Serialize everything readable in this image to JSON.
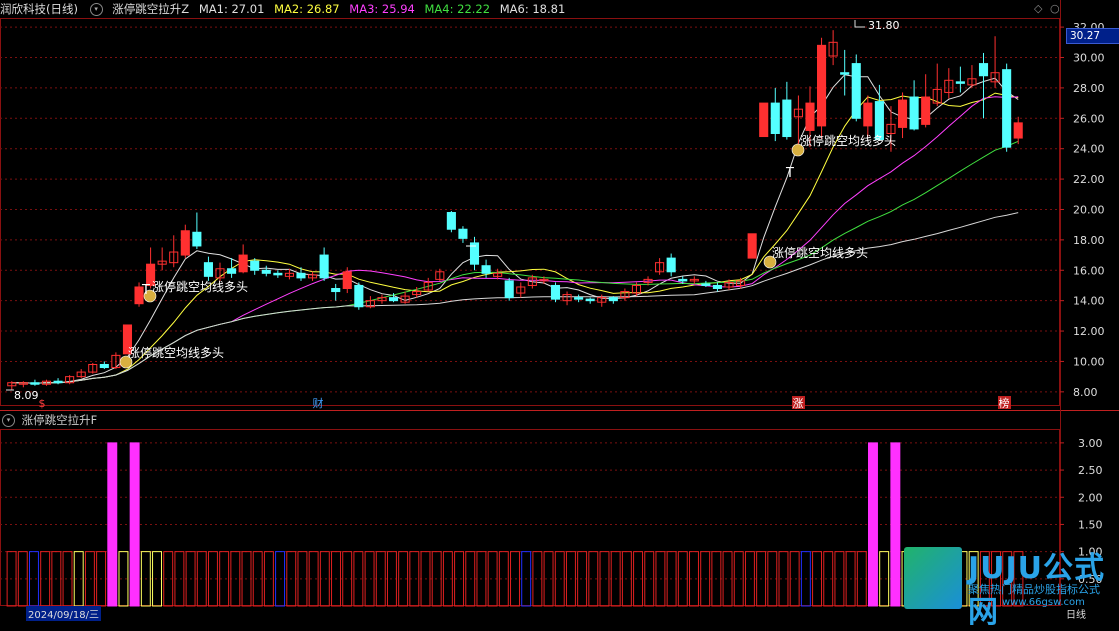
{
  "header": {
    "title": "润欣科技(日线)",
    "indicator": "涨停跳空拉升Z",
    "ma": [
      {
        "label": "MA1: 27.01",
        "color": "#e0e0e0"
      },
      {
        "label": "MA2: 26.87",
        "color": "#ffff40"
      },
      {
        "label": "MA3: 25.94",
        "color": "#ff40ff"
      },
      {
        "label": "MA4: 22.22",
        "color": "#40e040"
      },
      {
        "label": "MA6: 18.81",
        "color": "#e0e0e0"
      }
    ],
    "corner_icons": [
      "diamond-icon",
      "circle-icon"
    ]
  },
  "price_tag": "30.27",
  "sub_header": "涨停跳空拉升F",
  "bottom": {
    "date_label": "2024/09/18/三",
    "right_label": "日线"
  },
  "logo": {
    "title": "JUJU公式网",
    "slogan": "聚焦热门精品炒股指标公式",
    "url": "www.66gsw.com"
  },
  "chart_data": [
    {
      "type": "candlestick",
      "y_ticks": [
        "32.00",
        "30.00",
        "28.00",
        "26.00",
        "24.00",
        "22.00",
        "20.00",
        "18.00",
        "16.00",
        "14.00",
        "12.00",
        "10.00",
        "8.00"
      ],
      "ylim": [
        7.2,
        32.6
      ],
      "annotations": {
        "high_label": "31.80",
        "low_label": "8.09",
        "signal_text": "涨停跳空均线多头",
        "marker_letter": "T"
      },
      "event_labels": [
        "$",
        "财",
        "涨",
        "榜"
      ],
      "candles": [
        {
          "o": 8.4,
          "c": 8.6,
          "h": 8.7,
          "l": 8.1
        },
        {
          "o": 8.5,
          "c": 8.6,
          "h": 8.7,
          "l": 8.3
        },
        {
          "o": 8.6,
          "c": 8.5,
          "h": 8.8,
          "l": 8.4
        },
        {
          "o": 8.5,
          "c": 8.7,
          "h": 8.8,
          "l": 8.4
        },
        {
          "o": 8.7,
          "c": 8.6,
          "h": 8.9,
          "l": 8.5
        },
        {
          "o": 8.6,
          "c": 9.0,
          "h": 9.1,
          "l": 8.5
        },
        {
          "o": 9.0,
          "c": 9.3,
          "h": 9.5,
          "l": 8.9
        },
        {
          "o": 9.3,
          "c": 9.8,
          "h": 9.9,
          "l": 9.2
        },
        {
          "o": 9.8,
          "c": 9.6,
          "h": 10.0,
          "l": 9.5
        },
        {
          "o": 9.6,
          "c": 10.4,
          "h": 10.6,
          "l": 9.5
        },
        {
          "o": 10.5,
          "c": 12.4,
          "h": 12.4,
          "l": 10.5
        },
        {
          "o": 13.8,
          "c": 14.9,
          "h": 15.2,
          "l": 13.6
        },
        {
          "o": 15.0,
          "c": 16.4,
          "h": 17.5,
          "l": 14.8
        },
        {
          "o": 16.4,
          "c": 16.6,
          "h": 17.5,
          "l": 16.0
        },
        {
          "o": 16.5,
          "c": 17.2,
          "h": 18.3,
          "l": 16.2
        },
        {
          "o": 17.0,
          "c": 18.6,
          "h": 19.0,
          "l": 16.8
        },
        {
          "o": 18.5,
          "c": 17.6,
          "h": 19.8,
          "l": 17.4
        },
        {
          "o": 16.5,
          "c": 15.6,
          "h": 16.9,
          "l": 15.3
        },
        {
          "o": 15.5,
          "c": 16.1,
          "h": 16.5,
          "l": 15.3
        },
        {
          "o": 16.1,
          "c": 15.8,
          "h": 16.8,
          "l": 15.5
        },
        {
          "o": 15.9,
          "c": 17.0,
          "h": 17.7,
          "l": 15.8
        },
        {
          "o": 16.6,
          "c": 16.0,
          "h": 16.8,
          "l": 15.7
        },
        {
          "o": 16.0,
          "c": 15.8,
          "h": 16.3,
          "l": 15.6
        },
        {
          "o": 15.8,
          "c": 15.7,
          "h": 16.0,
          "l": 15.5
        },
        {
          "o": 15.6,
          "c": 15.8,
          "h": 16.1,
          "l": 15.4
        },
        {
          "o": 15.8,
          "c": 15.5,
          "h": 16.2,
          "l": 15.3
        },
        {
          "o": 15.5,
          "c": 15.7,
          "h": 15.9,
          "l": 15.3
        },
        {
          "o": 17.0,
          "c": 15.5,
          "h": 17.5,
          "l": 15.3
        },
        {
          "o": 14.8,
          "c": 14.6,
          "h": 15.1,
          "l": 14.0
        },
        {
          "o": 14.8,
          "c": 15.9,
          "h": 16.2,
          "l": 14.5
        },
        {
          "o": 15.0,
          "c": 13.6,
          "h": 15.2,
          "l": 13.4
        },
        {
          "o": 13.6,
          "c": 14.0,
          "h": 14.3,
          "l": 13.5
        },
        {
          "o": 14.0,
          "c": 14.2,
          "h": 14.4,
          "l": 13.8
        },
        {
          "o": 14.2,
          "c": 14.0,
          "h": 14.5,
          "l": 13.9
        },
        {
          "o": 13.9,
          "c": 14.3,
          "h": 14.6,
          "l": 13.8
        },
        {
          "o": 14.4,
          "c": 14.6,
          "h": 14.9,
          "l": 14.2
        },
        {
          "o": 14.7,
          "c": 15.2,
          "h": 15.5,
          "l": 14.6
        },
        {
          "o": 15.4,
          "c": 15.9,
          "h": 16.1,
          "l": 15.3
        },
        {
          "o": 19.8,
          "c": 18.7,
          "h": 19.9,
          "l": 18.5
        },
        {
          "o": 18.7,
          "c": 18.1,
          "h": 18.9,
          "l": 17.8
        },
        {
          "o": 17.8,
          "c": 16.4,
          "h": 18.2,
          "l": 16.0
        },
        {
          "o": 16.3,
          "c": 15.8,
          "h": 16.7,
          "l": 15.5
        },
        {
          "o": 15.6,
          "c": 15.8,
          "h": 16.1,
          "l": 15.4
        },
        {
          "o": 15.3,
          "c": 14.2,
          "h": 15.5,
          "l": 14.0
        },
        {
          "o": 14.5,
          "c": 14.9,
          "h": 15.2,
          "l": 14.2
        },
        {
          "o": 15.0,
          "c": 15.5,
          "h": 15.7,
          "l": 14.8
        },
        {
          "o": 15.3,
          "c": 15.4,
          "h": 15.6,
          "l": 15.1
        },
        {
          "o": 15.0,
          "c": 14.1,
          "h": 15.2,
          "l": 13.9
        },
        {
          "o": 14.0,
          "c": 14.4,
          "h": 14.6,
          "l": 13.7
        },
        {
          "o": 14.2,
          "c": 14.1,
          "h": 14.4,
          "l": 13.9
        },
        {
          "o": 14.1,
          "c": 14.0,
          "h": 14.2,
          "l": 13.8
        },
        {
          "o": 13.9,
          "c": 14.2,
          "h": 14.4,
          "l": 13.6
        },
        {
          "o": 14.2,
          "c": 14.0,
          "h": 14.3,
          "l": 13.8
        },
        {
          "o": 14.2,
          "c": 14.6,
          "h": 14.8,
          "l": 14.0
        },
        {
          "o": 14.5,
          "c": 15.0,
          "h": 15.2,
          "l": 14.3
        },
        {
          "o": 15.2,
          "c": 15.4,
          "h": 15.6,
          "l": 15.0
        },
        {
          "o": 15.9,
          "c": 16.5,
          "h": 16.8,
          "l": 15.7
        },
        {
          "o": 16.8,
          "c": 15.9,
          "h": 17.1,
          "l": 15.6
        },
        {
          "o": 15.4,
          "c": 15.3,
          "h": 15.6,
          "l": 15.1
        },
        {
          "o": 15.3,
          "c": 15.4,
          "h": 15.6,
          "l": 15.1
        },
        {
          "o": 15.1,
          "c": 15.0,
          "h": 15.3,
          "l": 14.9
        },
        {
          "o": 15.0,
          "c": 14.8,
          "h": 15.2,
          "l": 14.6
        },
        {
          "o": 14.9,
          "c": 15.2,
          "h": 15.4,
          "l": 14.7
        },
        {
          "o": 15.0,
          "c": 15.3,
          "h": 15.5,
          "l": 14.8
        },
        {
          "o": 16.8,
          "c": 18.4,
          "h": 18.4,
          "l": 16.8
        },
        {
          "o": 24.8,
          "c": 27.0,
          "h": 27.0,
          "l": 24.8
        },
        {
          "o": 27.0,
          "c": 25.0,
          "h": 28.0,
          "l": 24.5
        },
        {
          "o": 27.2,
          "c": 24.8,
          "h": 28.4,
          "l": 24.6
        },
        {
          "o": 26.1,
          "c": 26.6,
          "h": 27.5,
          "l": 24.0
        },
        {
          "o": 25.2,
          "c": 27.0,
          "h": 28.1,
          "l": 24.1
        },
        {
          "o": 25.5,
          "c": 30.8,
          "h": 31.3,
          "l": 24.6
        },
        {
          "o": 30.1,
          "c": 31.0,
          "h": 31.8,
          "l": 29.5
        },
        {
          "o": 29.0,
          "c": 28.9,
          "h": 30.5,
          "l": 27.5
        },
        {
          "o": 29.6,
          "c": 26.0,
          "h": 30.2,
          "l": 25.8
        },
        {
          "o": 25.5,
          "c": 27.0,
          "h": 27.5,
          "l": 24.8
        },
        {
          "o": 27.1,
          "c": 24.6,
          "h": 28.2,
          "l": 24.6
        },
        {
          "o": 25.0,
          "c": 25.6,
          "h": 26.8,
          "l": 23.8
        },
        {
          "o": 25.4,
          "c": 27.2,
          "h": 27.7,
          "l": 24.7
        },
        {
          "o": 27.4,
          "c": 25.3,
          "h": 28.5,
          "l": 25.2
        },
        {
          "o": 25.6,
          "c": 27.4,
          "h": 28.9,
          "l": 25.4
        },
        {
          "o": 27.0,
          "c": 27.9,
          "h": 29.6,
          "l": 26.8
        },
        {
          "o": 27.7,
          "c": 28.5,
          "h": 29.3,
          "l": 27.3
        },
        {
          "o": 28.4,
          "c": 28.3,
          "h": 29.4,
          "l": 27.7
        },
        {
          "o": 28.2,
          "c": 28.6,
          "h": 29.5,
          "l": 28.0
        },
        {
          "o": 29.6,
          "c": 28.8,
          "h": 30.3,
          "l": 26.0
        },
        {
          "o": 28.4,
          "c": 29.0,
          "h": 31.4,
          "l": 28.0
        },
        {
          "o": 29.2,
          "c": 24.1,
          "h": 29.6,
          "l": 23.8
        },
        {
          "o": 24.7,
          "c": 25.7,
          "h": 26.1,
          "l": 24.3
        }
      ]
    },
    {
      "type": "bar",
      "name": "涨停跳空拉升F",
      "y_ticks": [
        "3.00",
        "2.50",
        "2.00",
        "1.50",
        "1.00",
        "0.50"
      ],
      "ylim": [
        0,
        3.2
      ],
      "bars": [
        {
          "v": 1,
          "c": "#e02020",
          "f": 0
        },
        {
          "v": 1,
          "c": "#e02020",
          "f": 0
        },
        {
          "v": 1,
          "c": "#2030ff",
          "f": 0
        },
        {
          "v": 1,
          "c": "#e02020",
          "f": 0
        },
        {
          "v": 1,
          "c": "#e02020",
          "f": 0
        },
        {
          "v": 1,
          "c": "#e02020",
          "f": 0
        },
        {
          "v": 1,
          "c": "#ffff60",
          "f": 0
        },
        {
          "v": 1,
          "c": "#e02020",
          "f": 0
        },
        {
          "v": 1,
          "c": "#e02020",
          "f": 0
        },
        {
          "v": 3,
          "c": "#ff30ff",
          "f": 1
        },
        {
          "v": 1,
          "c": "#ffff60",
          "f": 0
        },
        {
          "v": 3,
          "c": "#ff30ff",
          "f": 1
        },
        {
          "v": 1,
          "c": "#ffff60",
          "f": 0
        },
        {
          "v": 1,
          "c": "#ffff60",
          "f": 0
        },
        {
          "v": 1,
          "c": "#e02020",
          "f": 0
        },
        {
          "v": 1,
          "c": "#e02020",
          "f": 0
        },
        {
          "v": 1,
          "c": "#e02020",
          "f": 0
        },
        {
          "v": 1,
          "c": "#e02020",
          "f": 0
        },
        {
          "v": 1,
          "c": "#e02020",
          "f": 0
        },
        {
          "v": 1,
          "c": "#e02020",
          "f": 0
        },
        {
          "v": 1,
          "c": "#e02020",
          "f": 0
        },
        {
          "v": 1,
          "c": "#e02020",
          "f": 0
        },
        {
          "v": 1,
          "c": "#e02020",
          "f": 0
        },
        {
          "v": 1,
          "c": "#e02020",
          "f": 0
        },
        {
          "v": 1,
          "c": "#2030ff",
          "f": 0
        },
        {
          "v": 1,
          "c": "#e02020",
          "f": 0
        },
        {
          "v": 1,
          "c": "#e02020",
          "f": 0
        },
        {
          "v": 1,
          "c": "#e02020",
          "f": 0
        },
        {
          "v": 1,
          "c": "#e02020",
          "f": 0
        },
        {
          "v": 1,
          "c": "#e02020",
          "f": 0
        },
        {
          "v": 1,
          "c": "#e02020",
          "f": 0
        },
        {
          "v": 1,
          "c": "#e02020",
          "f": 0
        },
        {
          "v": 1,
          "c": "#e02020",
          "f": 0
        },
        {
          "v": 1,
          "c": "#e02020",
          "f": 0
        },
        {
          "v": 1,
          "c": "#e02020",
          "f": 0
        },
        {
          "v": 1,
          "c": "#e02020",
          "f": 0
        },
        {
          "v": 1,
          "c": "#e02020",
          "f": 0
        },
        {
          "v": 1,
          "c": "#e02020",
          "f": 0
        },
        {
          "v": 1,
          "c": "#e02020",
          "f": 0
        },
        {
          "v": 1,
          "c": "#e02020",
          "f": 0
        },
        {
          "v": 1,
          "c": "#e02020",
          "f": 0
        },
        {
          "v": 1,
          "c": "#e02020",
          "f": 0
        },
        {
          "v": 1,
          "c": "#e02020",
          "f": 0
        },
        {
          "v": 1,
          "c": "#e02020",
          "f": 0
        },
        {
          "v": 1,
          "c": "#e02020",
          "f": 0
        },
        {
          "v": 1,
          "c": "#e02020",
          "f": 0
        },
        {
          "v": 1,
          "c": "#2030ff",
          "f": 0
        },
        {
          "v": 1,
          "c": "#e02020",
          "f": 0
        },
        {
          "v": 1,
          "c": "#e02020",
          "f": 0
        },
        {
          "v": 1,
          "c": "#e02020",
          "f": 0
        },
        {
          "v": 1,
          "c": "#e02020",
          "f": 0
        },
        {
          "v": 1,
          "c": "#e02020",
          "f": 0
        },
        {
          "v": 1,
          "c": "#e02020",
          "f": 0
        },
        {
          "v": 1,
          "c": "#e02020",
          "f": 0
        },
        {
          "v": 1,
          "c": "#e02020",
          "f": 0
        },
        {
          "v": 1,
          "c": "#e02020",
          "f": 0
        },
        {
          "v": 1,
          "c": "#e02020",
          "f": 0
        },
        {
          "v": 1,
          "c": "#e02020",
          "f": 0
        },
        {
          "v": 1,
          "c": "#e02020",
          "f": 0
        },
        {
          "v": 1,
          "c": "#e02020",
          "f": 0
        },
        {
          "v": 1,
          "c": "#e02020",
          "f": 0
        },
        {
          "v": 1,
          "c": "#e02020",
          "f": 0
        },
        {
          "v": 1,
          "c": "#e02020",
          "f": 0
        },
        {
          "v": 1,
          "c": "#e02020",
          "f": 0
        },
        {
          "v": 1,
          "c": "#e02020",
          "f": 0
        },
        {
          "v": 1,
          "c": "#e02020",
          "f": 0
        },
        {
          "v": 1,
          "c": "#e02020",
          "f": 0
        },
        {
          "v": 1,
          "c": "#e02020",
          "f": 0
        },
        {
          "v": 1,
          "c": "#e02020",
          "f": 0
        },
        {
          "v": 1,
          "c": "#e02020",
          "f": 0
        },
        {
          "v": 1,
          "c": "#e02020",
          "f": 0
        },
        {
          "v": 1,
          "c": "#2030ff",
          "f": 0
        },
        {
          "v": 1,
          "c": "#e02020",
          "f": 0
        },
        {
          "v": 1,
          "c": "#e02020",
          "f": 0
        },
        {
          "v": 1,
          "c": "#e02020",
          "f": 0
        },
        {
          "v": 1,
          "c": "#e02020",
          "f": 0
        },
        {
          "v": 1,
          "c": "#e02020",
          "f": 0
        },
        {
          "v": 3,
          "c": "#ff30ff",
          "f": 1
        },
        {
          "v": 1,
          "c": "#ffff60",
          "f": 0
        },
        {
          "v": 3,
          "c": "#ff30ff",
          "f": 1
        },
        {
          "v": 1,
          "c": "#ffff60",
          "f": 0
        },
        {
          "v": 1,
          "c": "#ffff60",
          "f": 0
        },
        {
          "v": 1,
          "c": "#ffff60",
          "f": 0
        },
        {
          "v": 1,
          "c": "#ffff60",
          "f": 0
        },
        {
          "v": 1,
          "c": "#ffff60",
          "f": 0
        },
        {
          "v": 1,
          "c": "#ffff60",
          "f": 0
        },
        {
          "v": 1,
          "c": "#ffff60",
          "f": 0
        },
        {
          "v": 1,
          "c": "#e02020",
          "f": 0
        },
        {
          "v": 1,
          "c": "#e02020",
          "f": 0
        },
        {
          "v": 1,
          "c": "#e02020",
          "f": 0
        },
        {
          "v": 1,
          "c": "#e02020",
          "f": 0
        }
      ]
    }
  ]
}
